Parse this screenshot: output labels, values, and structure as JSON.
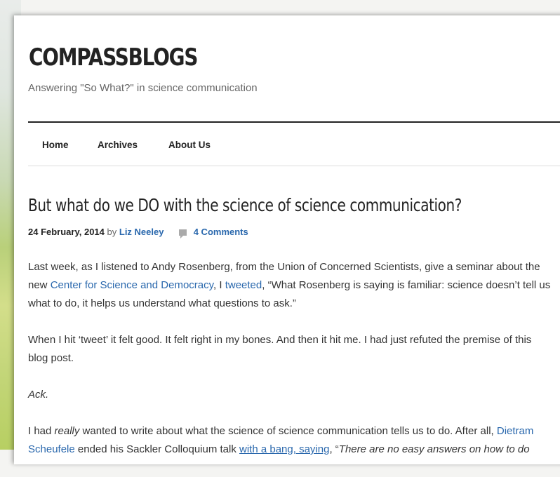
{
  "site": {
    "title": "COMPASSBLOGS",
    "tagline": "Answering \"So What?\" in science communication"
  },
  "nav": {
    "items": [
      {
        "label": "Home"
      },
      {
        "label": "Archives"
      },
      {
        "label": "About Us"
      }
    ]
  },
  "post": {
    "title": "But what do we DO with the science of science communication?",
    "date": "24 February, 2014",
    "by": "by",
    "author": "Liz Neeley",
    "comments": "4 Comments",
    "p1": {
      "t1": "Last week, as I listened to Andy Rosenberg, from the Union of Concerned Scientists, give a seminar about the new ",
      "link1": "Center for Science and Democracy",
      "t2": ", I ",
      "link2": "tweeted",
      "t3": ", “What Rosenberg is saying is familiar: science doesn’t tell us what to do, it helps us understand what questions to ask.”"
    },
    "p2": "When I hit ‘tweet’ it felt good. It felt right in my bones. And then it hit me.  I had just refuted the premise of this blog post.",
    "p3": "Ack.",
    "p4": {
      "t1": "I had ",
      "em1": "really",
      "t2": " wanted to write about what the science of science communication tells us to do. After all, ",
      "link1": "Dietram Scheufele",
      "t3": " ended his Sackler Colloquium talk ",
      "link2": "with a bang, saying",
      "t4": ", “",
      "em2": "There are no easy answers on how to do"
    }
  },
  "colors": {
    "link": "#2a68ad",
    "text": "#333333",
    "title": "#222222"
  },
  "icons": {
    "comments": "speech-bubble-icon"
  }
}
